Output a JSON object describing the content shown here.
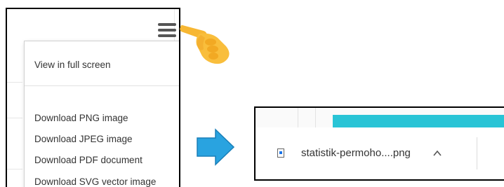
{
  "menu": {
    "items": [
      {
        "label": "View in full screen"
      },
      {
        "label": "Download PNG image"
      },
      {
        "label": "Download JPEG image"
      },
      {
        "label": "Download PDF document"
      },
      {
        "label": "Download SVG vector image"
      }
    ]
  },
  "download_bar": {
    "file_name": "statistik-permoho....png",
    "accent_color": "#29c4d6"
  },
  "icons": {
    "menu": "hamburger-icon",
    "pointer": "pointing-hand-icon",
    "arrow": "right-arrow-icon",
    "file": "image-file-icon",
    "chevron": "chevron-up-icon"
  }
}
